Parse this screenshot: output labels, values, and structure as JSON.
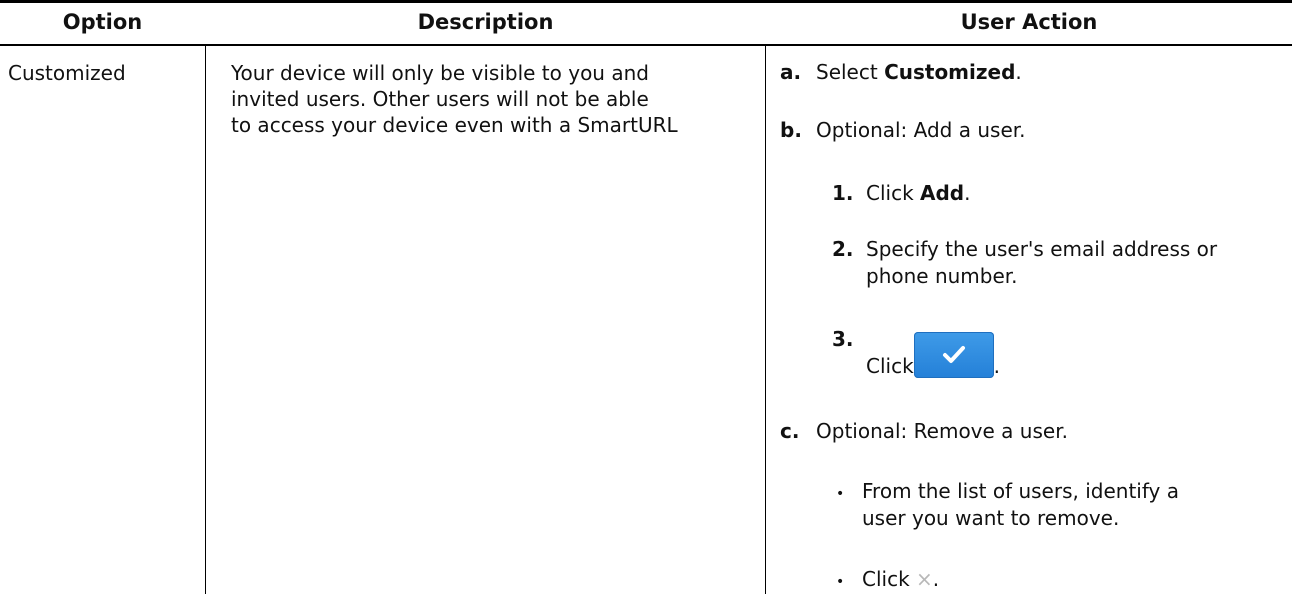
{
  "table": {
    "headers": {
      "option": "Option",
      "description": "Description",
      "user_action": "User Action"
    },
    "row": {
      "option": "Customized",
      "description_lines": [
        "Your device will only be visible to you and",
        "invited users. Other users will not be able",
        "to access your device even with a SmartURL"
      ],
      "steps": {
        "a": {
          "label": "a.",
          "text_prefix": "Select ",
          "bold": "Customized",
          "text_suffix": "."
        },
        "b": {
          "label": "b.",
          "text": "Optional: Add a user."
        },
        "b1": {
          "label": "1.",
          "text_prefix": "Click ",
          "bold": "Add",
          "text_suffix": "."
        },
        "b2": {
          "label": "2.",
          "line1": "Specify the user's email address or",
          "line2": "phone number."
        },
        "b3": {
          "label": "3.",
          "text_prefix": "Click",
          "text_suffix": ".",
          "icon": "checkmark-button-icon"
        },
        "c": {
          "label": "c.",
          "text": "Optional: Remove a user."
        },
        "c_bullet1": {
          "marker": "•",
          "line1": "From the list of users, identify a",
          "line2": "user you want to remove."
        },
        "c_bullet2": {
          "marker": "•",
          "text_prefix": "Click ",
          "icon": "close-icon",
          "icon_glyph": "×",
          "text_suffix": "."
        }
      }
    }
  }
}
